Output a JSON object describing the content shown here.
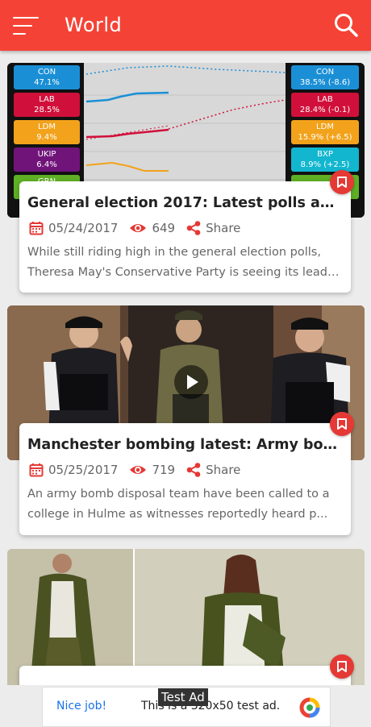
{
  "appbar": {
    "title": "World",
    "bg_color": "#f44336"
  },
  "articles": [
    {
      "title": "General election 2017: Latest polls and odd..",
      "date": "05/24/2017",
      "views": "649",
      "share_label": "Share",
      "excerpt": "While still riding high in the general election polls, Theresa May's Conservative Party is seeing its lead ...",
      "chart": {
        "left": [
          {
            "party": "CON",
            "value": "47.1%",
            "color": "#1a8fd6"
          },
          {
            "party": "LAB",
            "value": "28.5%",
            "color": "#d0103a"
          },
          {
            "party": "LDM",
            "value": "9.4%",
            "color": "#f2a21b"
          },
          {
            "party": "UKIP",
            "value": "6.4%",
            "color": "#70147a"
          },
          {
            "party": "GRN",
            "value": "",
            "color": "#5fb025"
          }
        ],
        "right": [
          {
            "party": "CON",
            "value": "38.5% (-8.6)",
            "color": "#1a8fd6"
          },
          {
            "party": "LAB",
            "value": "28.4% (-0.1)",
            "color": "#d0103a"
          },
          {
            "party": "LDM",
            "value": "15.9% (+6.5)",
            "color": "#f2a21b"
          },
          {
            "party": "BXP",
            "value": "8.9% (+2.5)",
            "color": "#12b6cf"
          },
          {
            "party": "",
            "value": "",
            "color": "#5fb025"
          }
        ]
      }
    },
    {
      "title": "Manchester bombing latest: Army bomb di..",
      "date": "05/25/2017",
      "views": "719",
      "share_label": "Share",
      "excerpt": "An army bomb disposal team have been called to a college in Hulme as witnesses reportedly heard p..."
    },
    {
      "title": "",
      "date": "",
      "views": "",
      "share_label": "",
      "excerpt": ""
    }
  ],
  "ad": {
    "tag": "Test Ad",
    "nice": "Nice job!",
    "text": "This is a 320x50 test ad."
  },
  "colors": {
    "accent": "#e53935",
    "text_dark": "#222222",
    "text_muted": "#666666"
  }
}
